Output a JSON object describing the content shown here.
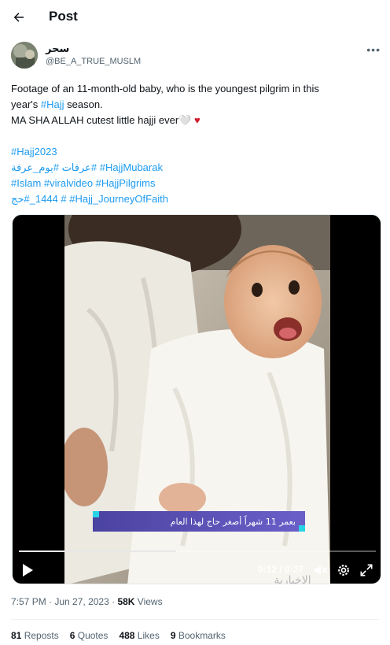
{
  "header": {
    "title": "Post"
  },
  "author": {
    "display_name": "سحر",
    "handle": "@BE_A_TRUE_MUSLM"
  },
  "tweet": {
    "line1": "Footage of an 11-month-old baby, who is the youngest pilgrim in this",
    "line2_prefix": "year's ",
    "line2_tag": "#Hajj",
    "line2_suffix": " season.",
    "line3": "MA SHA ALLAH cutest little hajji ever",
    "line3_emoji1": "🤍",
    "line3_emoji2": "♥",
    "hashtags_line1": "#Hajj2023",
    "hashtags_line2": "‏#عرفات #يوم_عرفة #HajjMubarak",
    "hashtags_line3": "#Islam  #viralvideo #HajjPilgrims",
    "hashtags_line4": "‏1444_#حج # #Hajj_JourneyOfFaith"
  },
  "video": {
    "caption": "بعمر 11 شهراً أصغر حاج لهذا العام",
    "time": "0:12 / 0:27",
    "progress": 0.44,
    "watermark": "الإخبارية"
  },
  "meta": {
    "time": "7:57 PM",
    "separator": " · ",
    "date": "Jun 27, 2023",
    "views_count": "58K",
    "views_label": " Views"
  },
  "stats": {
    "reposts_count": "81",
    "reposts_label": " Reposts",
    "quotes_count": "6",
    "quotes_label": " Quotes",
    "likes_count": "488",
    "likes_label": " Likes",
    "bookmarks_count": "9",
    "bookmarks_label": " Bookmarks"
  },
  "colors": {
    "link": "#1d9bf0",
    "heart": "#d11a2a",
    "secondary_text": "#536471",
    "caption_bar": "#5b51b8"
  },
  "icons": [
    "back-arrow-icon",
    "more-icon",
    "play-icon",
    "volume-icon",
    "settings-icon",
    "fullscreen-icon"
  ]
}
